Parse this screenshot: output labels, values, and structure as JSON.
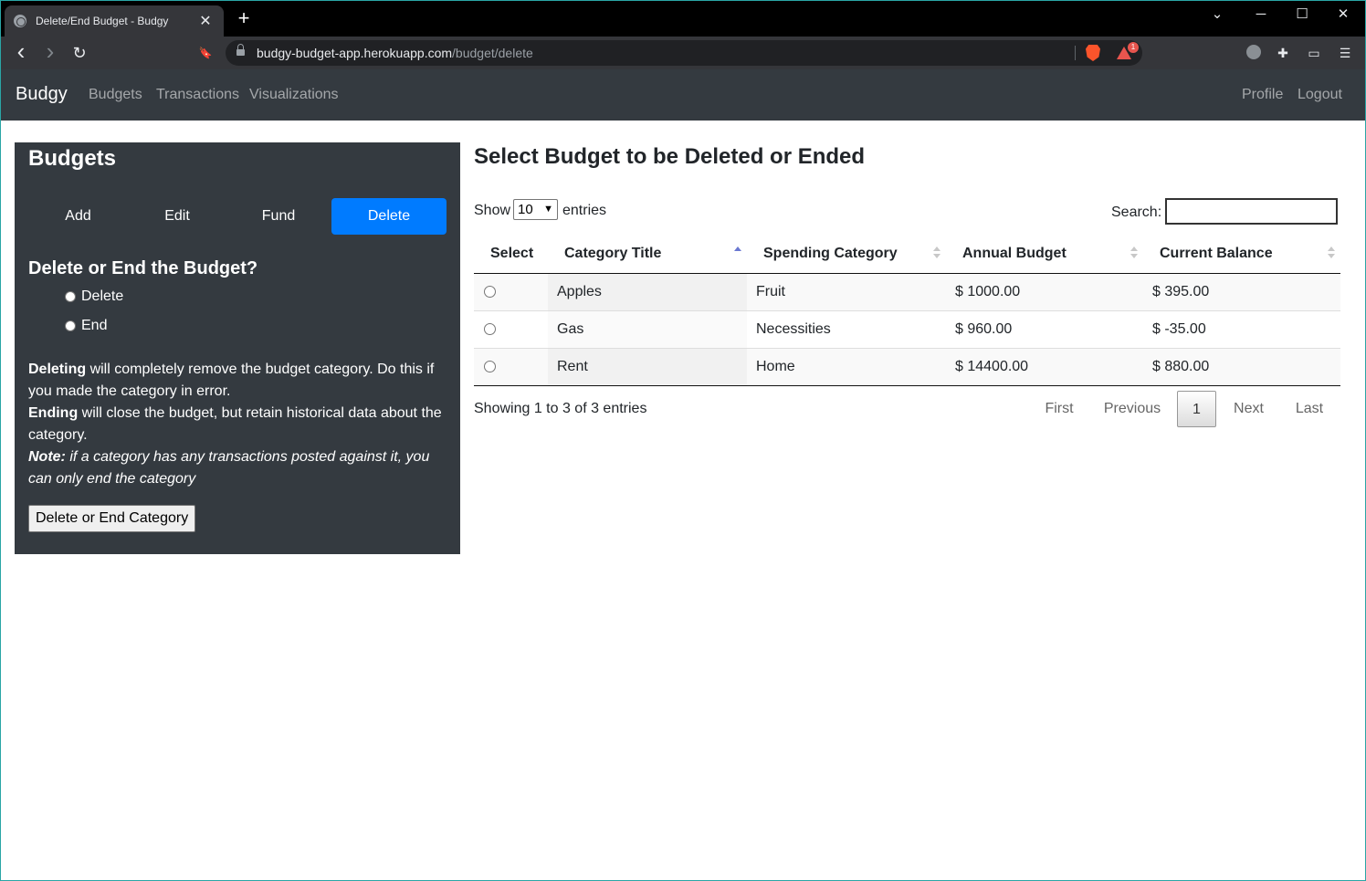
{
  "browser": {
    "tab_title": "Delete/End Budget - Budgy",
    "tab_close": "✕",
    "new_tab": "+",
    "url_host": "budgy-budget-app.herokuapp.com",
    "url_path": "/budget/delete",
    "rewards_badge": "1",
    "icons": {
      "back": "‹",
      "forward": "›",
      "reload": "↻",
      "bookmark": "🔖",
      "minimize": "─",
      "maximize": "☐",
      "close": "✕",
      "menu": "☰",
      "extensions": "✚",
      "wallet": "▭",
      "chevron": "⌄"
    }
  },
  "navbar": {
    "brand": "Budgy",
    "links": [
      "Budgets",
      "Transactions",
      "Visualizations"
    ],
    "right_links": [
      "Profile",
      "Logout"
    ]
  },
  "sidebar": {
    "title": "Budgets",
    "pills": [
      "Add",
      "Edit",
      "Fund",
      "Delete"
    ],
    "active_pill": "Delete",
    "question": "Delete or End the Budget?",
    "options": [
      "Delete",
      "End"
    ],
    "desc": {
      "deleting_bold": "Deleting",
      "deleting_text": " will completely remove the budget category. Do this if you made the category in error.",
      "ending_bold": "Ending",
      "ending_text": " will close the budget, but retain historical data about the category.",
      "note_bold": "Note:",
      "note_text": " if a category has any transactions posted against it, you can only end the category"
    },
    "submit_label": "Delete or End Category"
  },
  "main": {
    "title": "Select Budget to be Deleted or Ended",
    "show_label": "Show",
    "entries_selected": "10",
    "entries_label": "entries",
    "search_label": "Search:",
    "columns": [
      "Select",
      "Category Title",
      "Spending Category",
      "Annual Budget",
      "Current Balance"
    ],
    "rows": [
      {
        "title": "Apples",
        "category": "Fruit",
        "annual": "$ 1000.00",
        "balance": "$ 395.00"
      },
      {
        "title": "Gas",
        "category": "Necessities",
        "annual": "$ 960.00",
        "balance": "$ -35.00"
      },
      {
        "title": "Rent",
        "category": "Home",
        "annual": "$ 14400.00",
        "balance": "$ 880.00"
      }
    ],
    "info": "Showing 1 to 3 of 3 entries",
    "pagination": {
      "first": "First",
      "previous": "Previous",
      "current": "1",
      "next": "Next",
      "last": "Last"
    }
  },
  "colors": {
    "navbar_bg": "#343a40",
    "accent": "#007bff",
    "sort_active": "#6a78d1"
  }
}
